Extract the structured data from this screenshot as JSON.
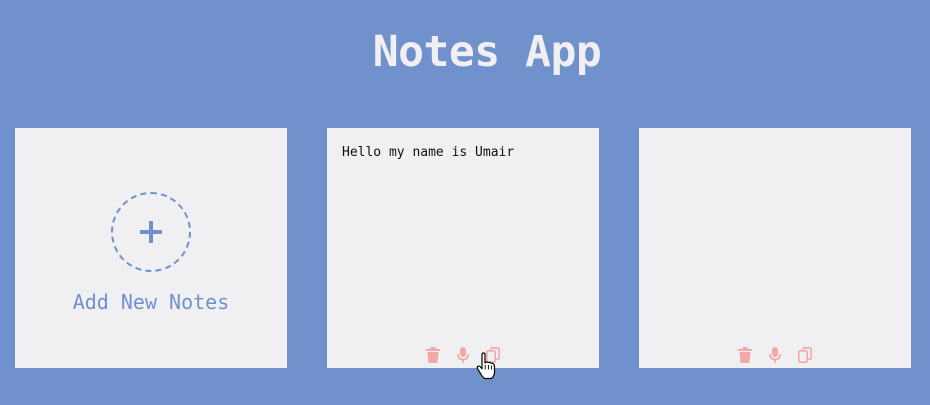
{
  "app": {
    "title": "Notes App"
  },
  "add_card": {
    "label": "Add New Notes",
    "icon": "plus-icon"
  },
  "notes": [
    {
      "text": "Hello my name is Umair",
      "actions": [
        "trash-icon",
        "microphone-icon",
        "copy-icon"
      ]
    },
    {
      "text": "",
      "actions": [
        "trash-icon",
        "microphone-icon",
        "copy-icon"
      ]
    }
  ],
  "colors": {
    "background": "#7191cd",
    "card": "#f0f0f2",
    "accent": "#7191cd",
    "action_icons": "#f2a8a6",
    "title_text": "#f0f0f3"
  }
}
